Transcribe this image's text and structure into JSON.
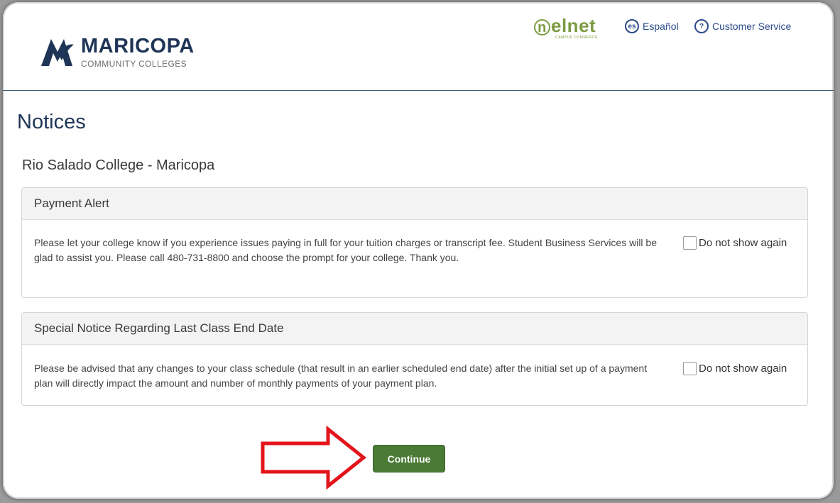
{
  "header": {
    "logo": {
      "name": "MARICOPA",
      "subtitle": "COMMUNITY COLLEGES"
    },
    "partner": {
      "name": "elnet",
      "initial": "n",
      "tagline": "CAMPUS COMMERCE"
    },
    "language": {
      "icon_text": "es",
      "label": "Español"
    },
    "support": {
      "icon_text": "?",
      "label": "Customer Service"
    }
  },
  "page": {
    "title": "Notices",
    "institution": "Rio Salado College - Maricopa"
  },
  "notices": [
    {
      "heading": "Payment Alert",
      "body": "Please let your college know if you experience issues paying in full for your tuition charges or transcript fee.  Student Business Services will be glad to assist you.  Please call 480-731-8800 and choose the prompt for your college.  Thank you.",
      "checkbox_label": "Do not show again",
      "checked": false
    },
    {
      "heading": "Special Notice Regarding Last Class End Date",
      "body": "Please be advised that any changes to your class schedule (that result in an earlier scheduled end date) after the initial set up of a payment plan will directly impact the amount and number of monthly payments of your payment plan.",
      "checkbox_label": "Do not show again",
      "checked": false
    }
  ],
  "actions": {
    "continue_label": "Continue"
  },
  "colors": {
    "brand_navy": "#1f3557",
    "nelnet_green": "#7d9b43",
    "button_green": "#4a7a36",
    "link_blue": "#2b4b8a",
    "annotation_red": "#e3141b"
  },
  "annotation": {
    "icon": "red-arrow-icon"
  }
}
